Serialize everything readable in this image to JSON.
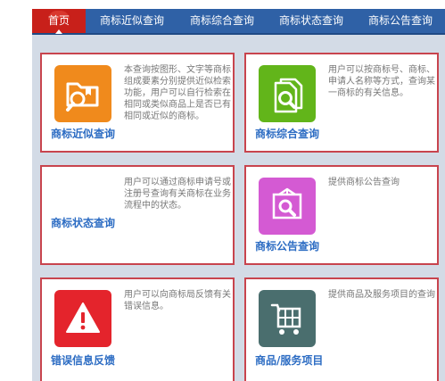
{
  "nav": {
    "items": [
      "首页",
      "商标近似查询",
      "商标综合查询",
      "商标状态查询",
      "商标公告查询"
    ]
  },
  "cards": [
    {
      "title": "商标近似查询",
      "desc": "本查询按图形、文字等商标组成要素分别提供近似检索功能，用户可以自行检索在相同或类似商品上是否已有相同或近似的商标。",
      "icon": "folder-search-icon",
      "color": "#f08a1c"
    },
    {
      "title": "商标综合查询",
      "desc": "用户可以按商标号、商标、申请人名称等方式，查询某一商标的有关信息。",
      "icon": "document-search-icon",
      "color": "#62b51a"
    },
    {
      "title": "商标状态查询",
      "desc": "用户可以通过商标申请号或注册号查询有关商标在业务流程中的状态。",
      "icon": "",
      "color": ""
    },
    {
      "title": "商标公告查询",
      "desc": "提供商标公告查询",
      "icon": "announcement-search-icon",
      "color": "#d45ad3"
    },
    {
      "title": "错误信息反馈",
      "desc": "用户可以向商标局反馈有关错误信息。",
      "icon": "warning-icon",
      "color": "#e4242c"
    },
    {
      "title": "商品/服务项目",
      "desc": "提供商品及服务项目的查询",
      "icon": "shopping-cart-icon",
      "color": "#4a6e6e"
    }
  ]
}
